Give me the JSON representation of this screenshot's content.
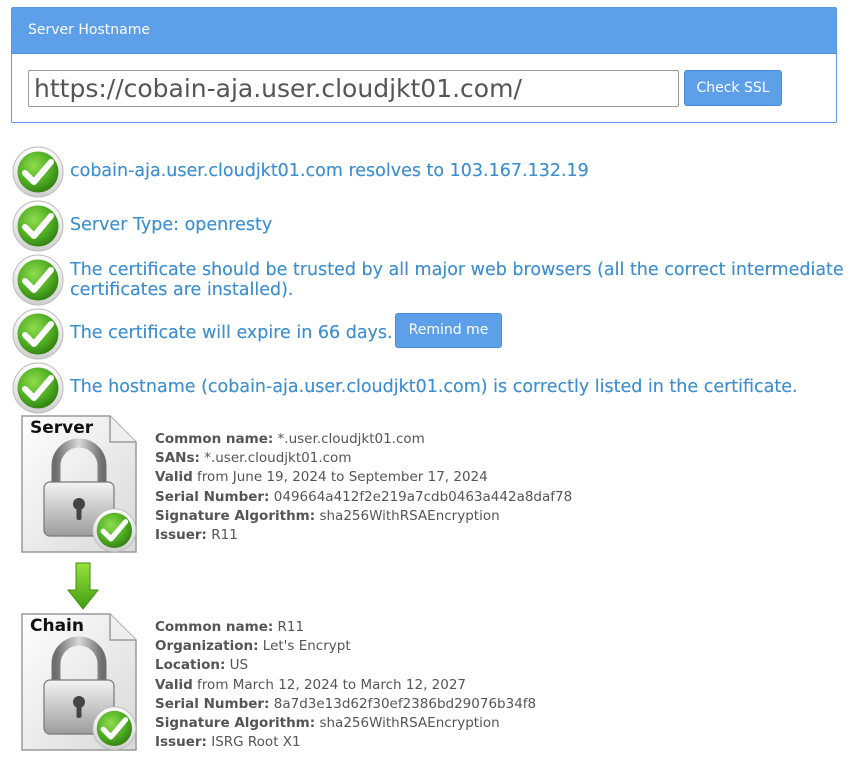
{
  "panel": {
    "title": "Server Hostname",
    "url_value": "https://cobain-aja.user.cloudjkt01.com/",
    "check_label": "Check SSL"
  },
  "results": [
    {
      "text": "cobain-aja.user.cloudjkt01.com resolves to 103.167.132.19"
    },
    {
      "text": "Server Type: openresty"
    },
    {
      "line1": "The certificate should be trusted by all major web browsers (all the correct intermediate",
      "line2": "certificates are installed)."
    },
    {
      "text": "The certificate will expire in 66 days.",
      "remind_label": "Remind me"
    },
    {
      "text": "The hostname (cobain-aja.user.cloudjkt01.com) is correctly listed in the certificate."
    }
  ],
  "server_cert": {
    "icon_label": "Server",
    "common_name_label": "Common name:",
    "common_name": "*.user.cloudjkt01.com",
    "sans_label": "SANs:",
    "sans": "*.user.cloudjkt01.com",
    "valid_label": "Valid",
    "valid": "from June 19, 2024 to September 17, 2024",
    "serial_label": "Serial Number:",
    "serial": "049664a412f2e219a7cdb0463a442a8daf78",
    "sig_label": "Signature Algorithm:",
    "sig": "sha256WithRSAEncryption",
    "issuer_label": "Issuer:",
    "issuer": "R11"
  },
  "chain_cert": {
    "icon_label": "Chain",
    "common_name_label": "Common name:",
    "common_name": "R11",
    "org_label": "Organization:",
    "org": "Let's Encrypt",
    "location_label": "Location:",
    "location": "US",
    "valid_label": "Valid",
    "valid": "from March 12, 2024 to March 12, 2027",
    "serial_label": "Serial Number:",
    "serial": "8a7d3e13d62f30ef2386bd29076b34f8",
    "sig_label": "Signature Algorithm:",
    "sig": "sha256WithRSAEncryption",
    "issuer_label": "Issuer:",
    "issuer": "ISRG Root X1"
  },
  "colors": {
    "accent": "#5d9fe8",
    "result_text": "#3d8fcf",
    "check_green": "#5fb82e"
  }
}
